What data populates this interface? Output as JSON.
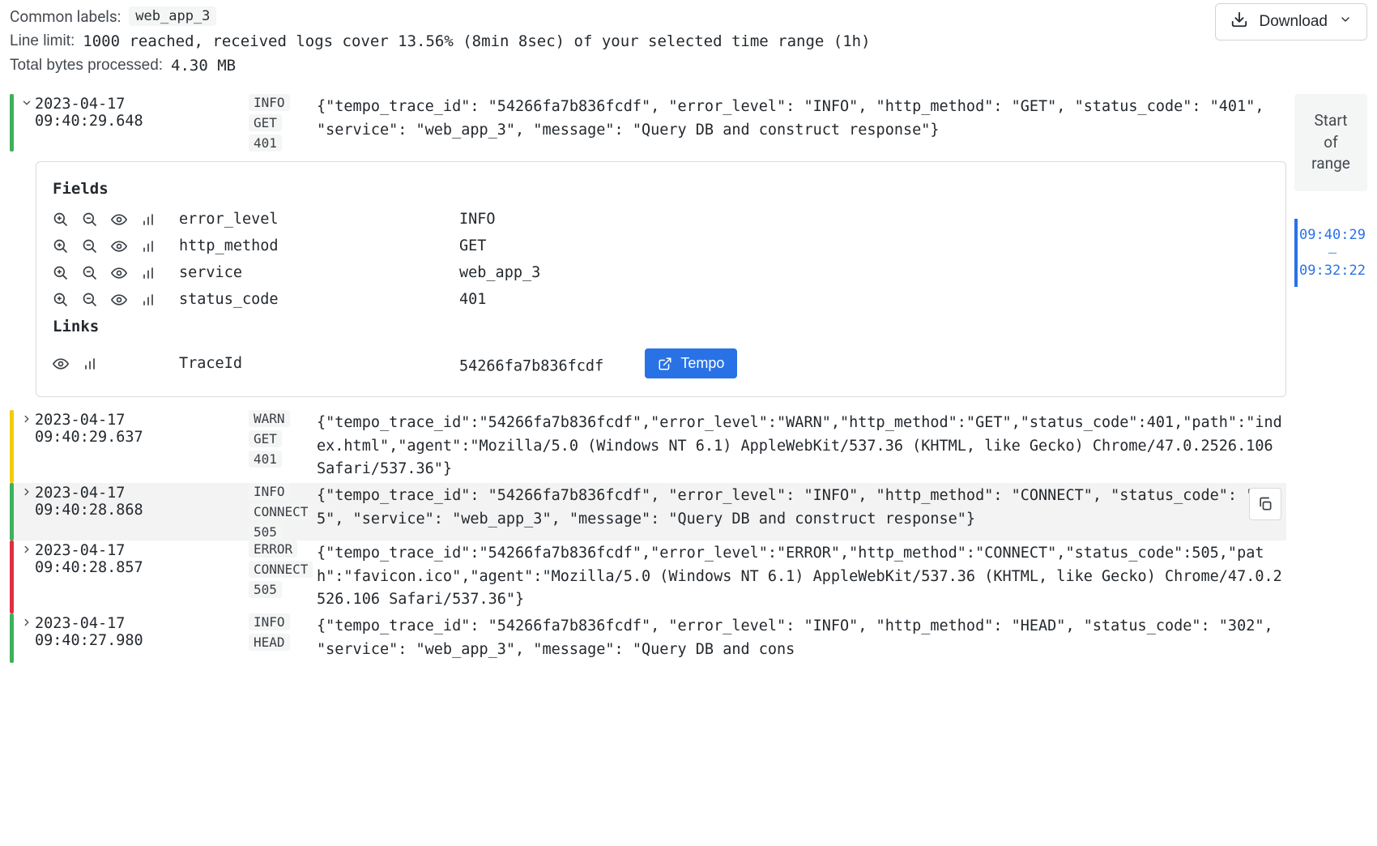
{
  "header": {
    "common_labels_label": "Common labels:",
    "common_labels_value": "web_app_3",
    "line_limit_label": "Line limit:",
    "line_limit_value": "1000  reached,  received logs cover 13.56% (8min 8sec) of your selected time range (1h)",
    "bytes_label": "Total bytes processed:",
    "bytes_value": "4.30 MB",
    "download_label": "Download"
  },
  "side": {
    "range_line1": "Start",
    "range_line2": "of",
    "range_line3": "range",
    "ts_top": "09:40:29",
    "ts_sep": "—",
    "ts_bottom": "09:32:22"
  },
  "details": {
    "fields_heading": "Fields",
    "links_heading": "Links",
    "fields": [
      {
        "key": "error_level",
        "val": "INFO"
      },
      {
        "key": "http_method",
        "val": "GET"
      },
      {
        "key": "service",
        "val": "web_app_3"
      },
      {
        "key": "status_code",
        "val": "401"
      }
    ],
    "link": {
      "key": "TraceId",
      "val": "54266fa7b836fcdf",
      "button": "Tempo"
    }
  },
  "logs": [
    {
      "level": "info",
      "expanded": true,
      "ts": "2023-04-17 09:40:29.648",
      "tags": [
        "INFO",
        "GET",
        "401"
      ],
      "body": "{\"tempo_trace_id\": \"54266fa7b836fcdf\", \"error_level\": \"INFO\", \"http_method\": \"GET\", \"status_code\": \"401\", \"service\": \"web_app_3\", \"message\": \"Query DB and construct response\"}"
    },
    {
      "level": "warn",
      "expanded": false,
      "ts": "2023-04-17 09:40:29.637",
      "tags": [
        "WARN",
        "GET",
        "401"
      ],
      "body": "{\"tempo_trace_id\":\"54266fa7b836fcdf\",\"error_level\":\"WARN\",\"http_method\":\"GET\",\"status_code\":401,\"path\":\"index.html\",\"agent\":\"Mozilla/5.0 (Windows NT 6.1) AppleWebKit/537.36 (KHTML, like Gecko) Chrome/47.0.2526.106 Safari/537.36\"}"
    },
    {
      "level": "info",
      "expanded": false,
      "hover": true,
      "ts": "2023-04-17 09:40:28.868",
      "tags": [
        "INFO",
        "CONNECT",
        "505"
      ],
      "body": "{\"tempo_trace_id\": \"54266fa7b836fcdf\", \"error_level\": \"INFO\", \"http_method\": \"CONNECT\", \"status_code\": \"505\", \"service\": \"web_app_3\", \"message\": \"Query DB and construct response\"}"
    },
    {
      "level": "error",
      "expanded": false,
      "ts": "2023-04-17 09:40:28.857",
      "tags": [
        "ERROR",
        "CONNECT",
        "505"
      ],
      "body": "{\"tempo_trace_id\":\"54266fa7b836fcdf\",\"error_level\":\"ERROR\",\"http_method\":\"CONNECT\",\"status_code\":505,\"path\":\"favicon.ico\",\"agent\":\"Mozilla/5.0 (Windows NT 6.1) AppleWebKit/537.36 (KHTML, like Gecko) Chrome/47.0.2526.106 Safari/537.36\"}"
    },
    {
      "level": "info",
      "expanded": false,
      "ts": "2023-04-17 09:40:27.980",
      "tags": [
        "INFO",
        "HEAD"
      ],
      "body": "{\"tempo_trace_id\": \"54266fa7b836fcdf\", \"error_level\": \"INFO\", \"http_method\": \"HEAD\", \"status_code\": \"302\", \"service\": \"web_app_3\", \"message\": \"Query DB and cons"
    }
  ]
}
